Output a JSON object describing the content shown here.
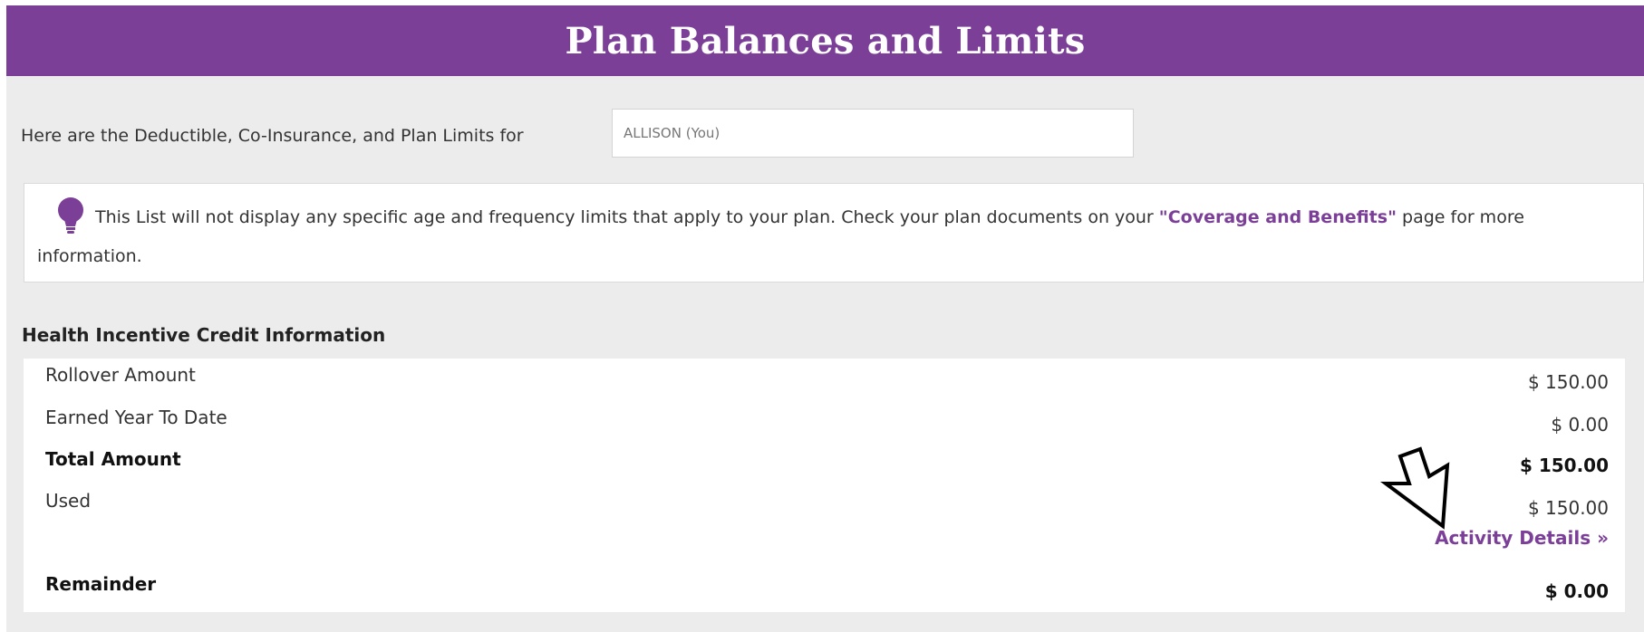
{
  "header": {
    "title": "Plan Balances and Limits"
  },
  "member_selector": {
    "label": "Here are the Deductible, Co-Insurance, and Plan Limits for",
    "selected": "ALLISON (You)"
  },
  "notice": {
    "icon": "lightbulb-icon",
    "text_before": "This List will not display any specific age and frequency limits that apply to your plan. Check your plan documents on your ",
    "link_text": "\"Coverage and Benefits\"",
    "text_after": " page for more information."
  },
  "health_incentive": {
    "title": "Health Incentive Credit Information",
    "rows": [
      {
        "label": "Rollover Amount",
        "value": "$ 150.00"
      },
      {
        "label": "Earned Year To Date",
        "value": "$ 0.00"
      },
      {
        "label": "Total Amount",
        "value": "$ 150.00"
      },
      {
        "label": "Used",
        "value": "$ 150.00"
      },
      {
        "label": "Remainder",
        "value": "$ 0.00"
      }
    ],
    "activity_link": "Activity Details »"
  },
  "colors": {
    "brand_purple": "#7b3f98",
    "page_background": "#ececec"
  }
}
